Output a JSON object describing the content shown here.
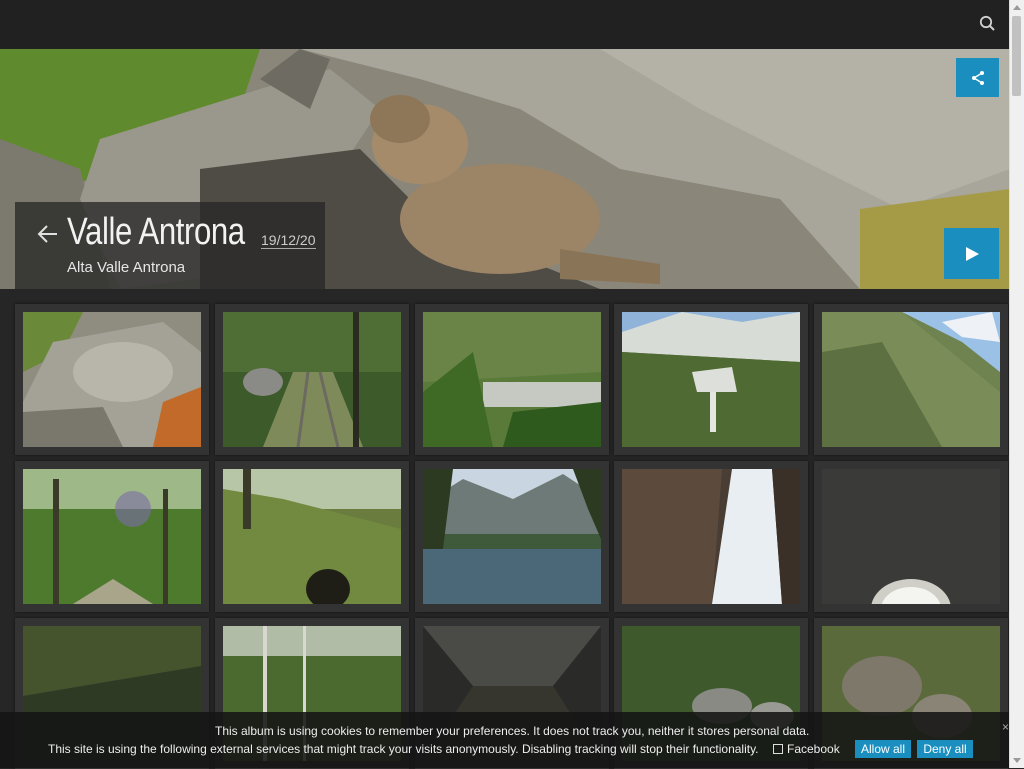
{
  "album": {
    "title": "Valle Antrona",
    "date": "19/12/20",
    "subtitle": "Alta Valle Antrona"
  },
  "header": {
    "search_icon": "search-icon",
    "share_icon": "share-icon",
    "play_icon": "play-icon",
    "back_icon": "arrow-left-icon"
  },
  "cookie": {
    "line1": "This album is using cookies to remember your preferences. It does not track you, neither it stores personal data.",
    "line2": "This site is using the following external services that might track your visits anonymously. Disabling tracking will stop their functionality.",
    "service": "Facebook",
    "allow_label": "Allow all",
    "deny_label": "Deny all",
    "close_label": "×"
  },
  "colors": {
    "accent": "#1a8fbf",
    "background": "#262626",
    "topbar": "#212121"
  },
  "thumbnails": [
    {
      "subject": "marmot on rocks"
    },
    {
      "subject": "forest rail track"
    },
    {
      "subject": "dam and lake in forest"
    },
    {
      "subject": "mountain waterfall with snow"
    },
    {
      "subject": "green mountain slope"
    },
    {
      "subject": "forest path"
    },
    {
      "subject": "tunnel in grassy slope"
    },
    {
      "subject": "mountain lake"
    },
    {
      "subject": "waterfall in gorge"
    },
    {
      "subject": "tunnel interior"
    },
    {
      "subject": "forest ravine"
    },
    {
      "subject": "birch trees"
    },
    {
      "subject": "concrete tunnel"
    },
    {
      "subject": "rocky river"
    },
    {
      "subject": "boulders"
    }
  ]
}
